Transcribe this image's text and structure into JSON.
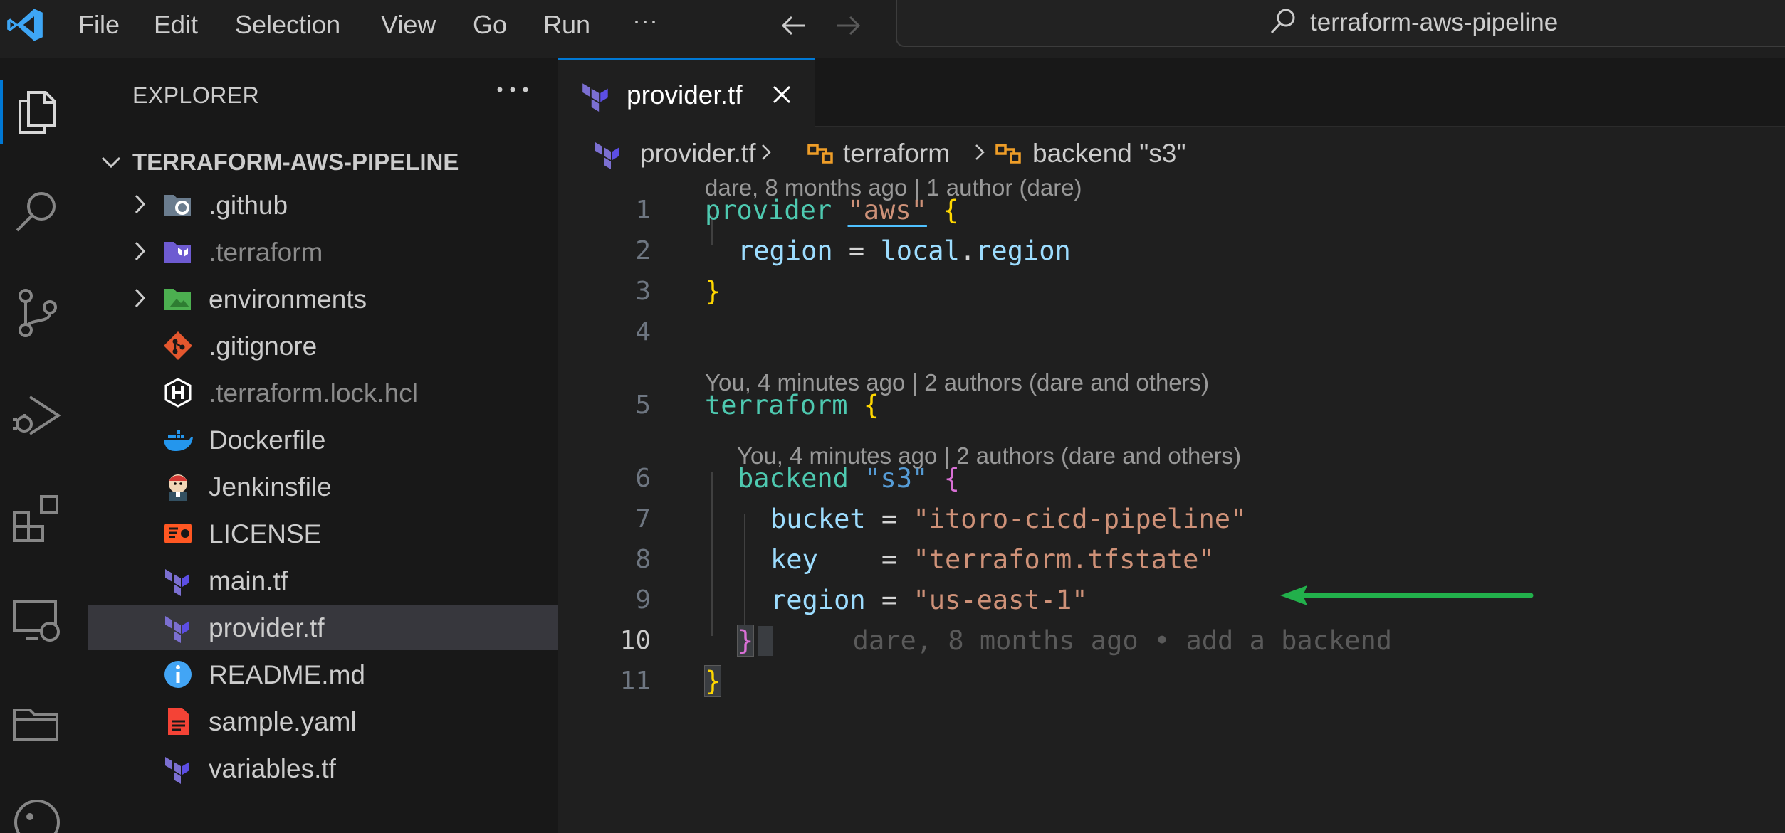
{
  "menu": {
    "file": "File",
    "edit": "Edit",
    "selection": "Selection",
    "view": "View",
    "go": "Go",
    "run": "Run",
    "more": "···"
  },
  "search": {
    "text": "terraform-aws-pipeline"
  },
  "explorer": {
    "title": "EXPLORER",
    "more": "···",
    "root": "TERRAFORM-AWS-PIPELINE",
    "items": [
      {
        "label": ".github",
        "icon": "github-folder-icon",
        "folder": true,
        "dim": false
      },
      {
        "label": ".terraform",
        "icon": "terraform-folder-icon",
        "folder": true,
        "dim": true
      },
      {
        "label": "environments",
        "icon": "environments-folder-icon",
        "folder": true,
        "dim": false
      },
      {
        "label": ".gitignore",
        "icon": "git-icon",
        "folder": false,
        "dim": false
      },
      {
        "label": ".terraform.lock.hcl",
        "icon": "hcl-icon",
        "folder": false,
        "dim": true
      },
      {
        "label": "Dockerfile",
        "icon": "docker-icon",
        "folder": false,
        "dim": false
      },
      {
        "label": "Jenkinsfile",
        "icon": "jenkins-icon",
        "folder": false,
        "dim": false
      },
      {
        "label": "LICENSE",
        "icon": "license-icon",
        "folder": false,
        "dim": false
      },
      {
        "label": "main.tf",
        "icon": "terraform-icon",
        "folder": false,
        "dim": false
      },
      {
        "label": "provider.tf",
        "icon": "terraform-icon",
        "folder": false,
        "dim": false,
        "selected": true
      },
      {
        "label": "README.md",
        "icon": "info-icon",
        "folder": false,
        "dim": false
      },
      {
        "label": "sample.yaml",
        "icon": "yaml-icon",
        "folder": false,
        "dim": false
      },
      {
        "label": "variables.tf",
        "icon": "terraform-icon",
        "folder": false,
        "dim": false
      }
    ]
  },
  "tab": {
    "label": "provider.tf",
    "close": "×"
  },
  "breadcrumb": {
    "file": "provider.tf",
    "block1": "terraform",
    "block2": "backend \"s3\""
  },
  "codelens": {
    "lens1": "dare, 8 months ago | 1 author (dare)",
    "lens2": "You, 4 minutes ago | 2 authors (dare and others)",
    "lens3": "You, 4 minutes ago | 2 authors (dare and others)"
  },
  "code": {
    "line_numbers": [
      "1",
      "2",
      "3",
      "4",
      "5",
      "6",
      "7",
      "8",
      "9",
      "10",
      "11"
    ],
    "l1_kw": "provider",
    "l1_str": "\"aws\"",
    "l1_brace": "{",
    "l2_key": "region",
    "l2_eq": " = ",
    "l2_val1": "local",
    "l2_dot": ".",
    "l2_val2": "region",
    "l3_brace": "}",
    "l5_kw": "terraform",
    "l5_brace": "{",
    "l6_kw": "backend",
    "l6_str": "\"s3\"",
    "l6_brace": "{",
    "l7_key": "bucket",
    "l7_eq": " = ",
    "l7_val": "\"itoro-cicd-pipeline\"",
    "l8_key": "key",
    "l8_eq": "    = ",
    "l8_val": "\"terraform.tfstate\"",
    "l9_key": "region",
    "l9_eq": " = ",
    "l9_val": "\"us-east-1\"",
    "l10_brace": "}",
    "l10_blame": "dare, 8 months ago • add a backend",
    "l11_brace": "}"
  },
  "colors": {
    "accent": "#0078d4",
    "annotation_arrow": "#22b04b"
  }
}
